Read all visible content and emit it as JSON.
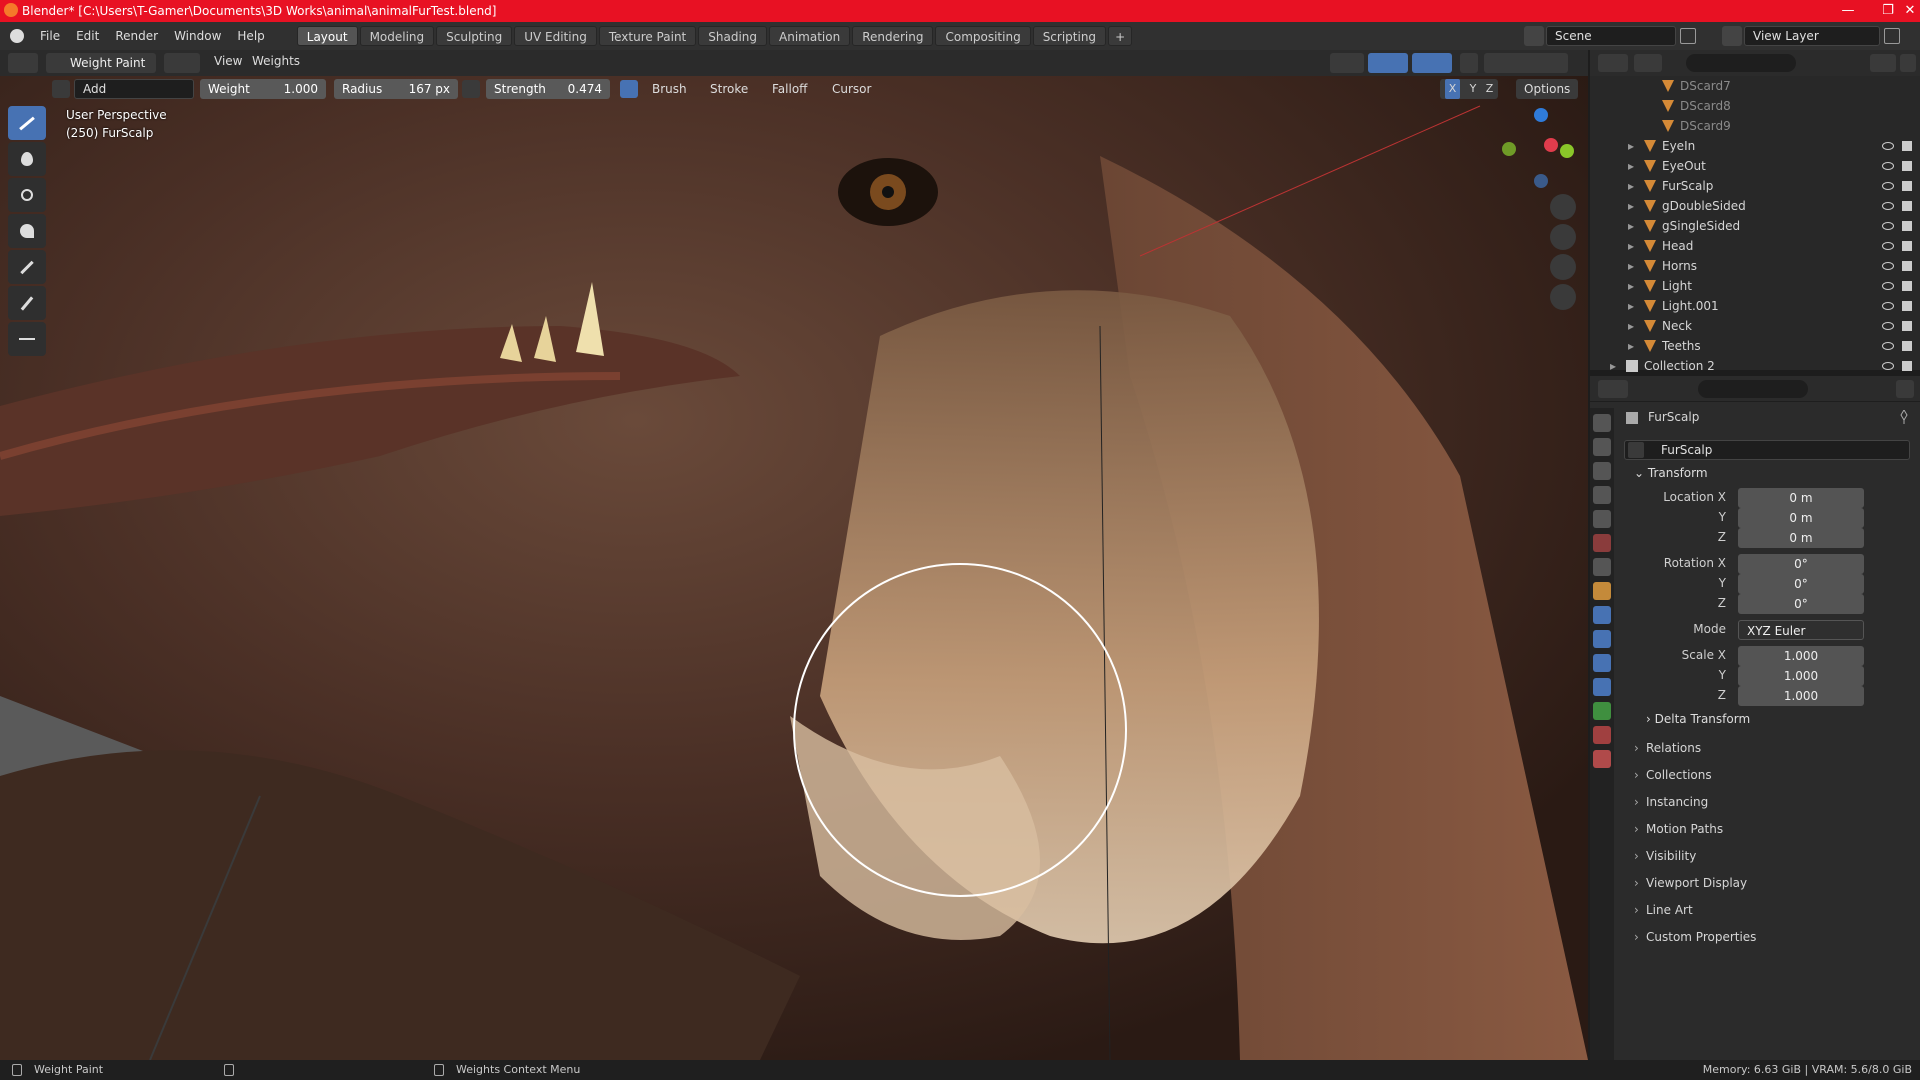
{
  "title": "Blender* [C:\\Users\\T-Gamer\\Documents\\3D Works\\animal\\animalFurTest.blend]",
  "menu": [
    "File",
    "Edit",
    "Render",
    "Window",
    "Help"
  ],
  "workspaces": [
    "Layout",
    "Modeling",
    "Sculpting",
    "UV Editing",
    "Texture Paint",
    "Shading",
    "Animation",
    "Rendering",
    "Compositing",
    "Scripting"
  ],
  "active_workspace": "Layout",
  "scene": "Scene",
  "view_layer": "View Layer",
  "mode": "Weight Paint",
  "header_menus": [
    "View",
    "Weights"
  ],
  "tool_settings": {
    "blend": "Add",
    "weight_label": "Weight",
    "weight_value": "1.000",
    "radius_label": "Radius",
    "radius_value": "167 px",
    "strength_label": "Strength",
    "strength_value": "0.474",
    "brush": "Brush",
    "stroke": "Stroke",
    "falloff": "Falloff",
    "cursor": "Cursor",
    "options": "Options",
    "axes": [
      "X",
      "Y",
      "Z"
    ]
  },
  "viewport": {
    "perspective": "User Perspective",
    "object": "(250) FurScalp"
  },
  "outliner": {
    "items": [
      {
        "name": "DScard7",
        "indent": 2
      },
      {
        "name": "DScard8",
        "indent": 2
      },
      {
        "name": "DScard9",
        "indent": 2
      },
      {
        "name": "EyeIn",
        "indent": 1
      },
      {
        "name": "EyeOut",
        "indent": 1
      },
      {
        "name": "FurScalp",
        "indent": 1
      },
      {
        "name": "gDoubleSided",
        "indent": 1
      },
      {
        "name": "gSingleSided",
        "indent": 1
      },
      {
        "name": "Head",
        "indent": 1
      },
      {
        "name": "Horns",
        "indent": 1
      },
      {
        "name": "Light",
        "indent": 1
      },
      {
        "name": "Light.001",
        "indent": 1
      },
      {
        "name": "Neck",
        "indent": 1
      },
      {
        "name": "Teeths",
        "indent": 1
      },
      {
        "name": "Collection 2",
        "indent": 0
      }
    ]
  },
  "properties": {
    "object_name": "FurScalp",
    "object_field": "FurScalp",
    "transform_label": "Transform",
    "location": {
      "label": "Location X",
      "x": "0 m",
      "y": "0 m",
      "z": "0 m"
    },
    "rotation": {
      "label": "Rotation X",
      "x": "0°",
      "y": "0°",
      "z": "0°"
    },
    "mode_label": "Mode",
    "mode_value": "XYZ Euler",
    "scale": {
      "label": "Scale X",
      "x": "1.000",
      "y": "1.000",
      "z": "1.000"
    },
    "axis_y": "Y",
    "axis_z": "Z",
    "delta_transform": "Delta Transform",
    "panels": [
      "Relations",
      "Collections",
      "Instancing",
      "Motion Paths",
      "Visibility",
      "Viewport Display",
      "Line Art",
      "Custom Properties"
    ]
  },
  "statusbar": {
    "left": "Weight Paint",
    "middle": "Weights Context Menu",
    "right": "Memory: 6.63 GiB | VRAM: 5.6/8.0 GiB"
  }
}
